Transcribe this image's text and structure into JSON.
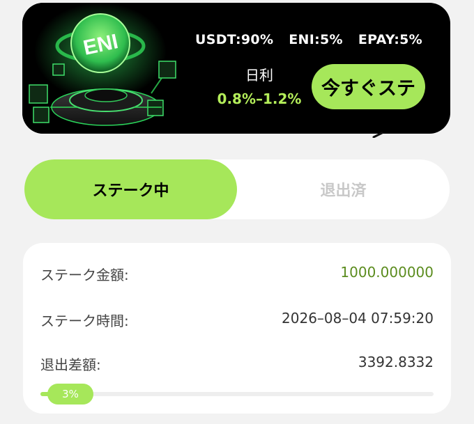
{
  "banner": {
    "logo_text": "ENI",
    "ratios": [
      "USDT:90%",
      "ENI:5%",
      "EPAY:5%"
    ],
    "daily_label": "日利",
    "daily_value": "0.8%–1.2%",
    "stake_now_label": "今すぐステ"
  },
  "tabs": {
    "active_label": "ステーク中",
    "inactive_label": "退出済"
  },
  "record": {
    "amount_label": "ステーク金額:",
    "amount_value": "1000.000000",
    "time_label": "ステーク時間:",
    "time_value": "2026–08–04 07:59:20",
    "exit_diff_label": "退出差額:",
    "exit_diff_value": "3392.8332",
    "progress_text": "3%",
    "progress_fraction": 0.03
  },
  "colors": {
    "accent": "#a6e75a",
    "accent_text": "#b4ee5a",
    "amount_green": "#5b8c1e",
    "banner_bg": "#000000",
    "page_bg": "#f2f2f2"
  },
  "icons": {
    "banner_art": "eni-coin-platform-illustration"
  }
}
